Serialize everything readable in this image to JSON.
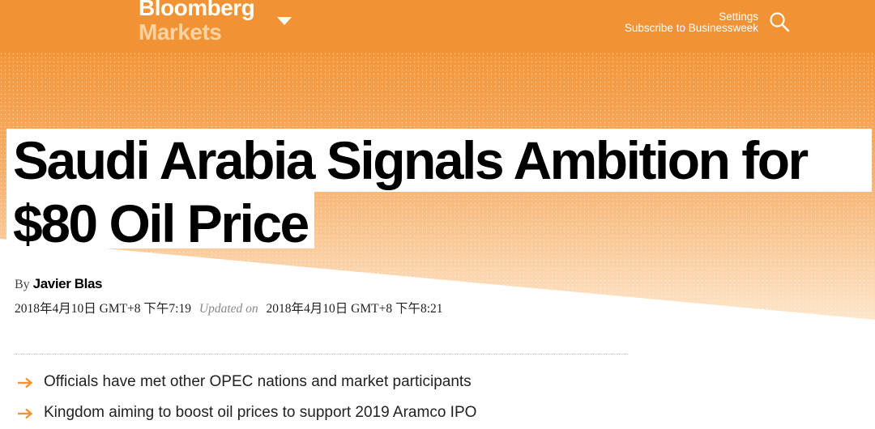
{
  "header": {
    "brand_line1": "Bloomberg",
    "brand_line2": "Markets",
    "settings_label": "Settings",
    "subscribe_label": "Subscribe to Businessweek",
    "bar_color": "#f19334"
  },
  "article": {
    "headline_line1": "Saudi Arabia Signals Ambition for",
    "headline_line2": "$80 Oil Price",
    "byline_prefix": "By",
    "author": "Javier Blas",
    "published": "2018年4月10日 GMT+8 下午7:19",
    "updated_label": "Updated on",
    "updated": "2018年4月10日 GMT+8 下午8:21",
    "bullets": [
      "Officials have met other OPEC nations and market participants",
      "Kingdom aiming to boost oil prices to support 2019 Aramco IPO"
    ],
    "accent_color": "#f19334"
  },
  "icons": [
    "chevron-down-icon",
    "search-icon",
    "arrow-right-icon"
  ]
}
